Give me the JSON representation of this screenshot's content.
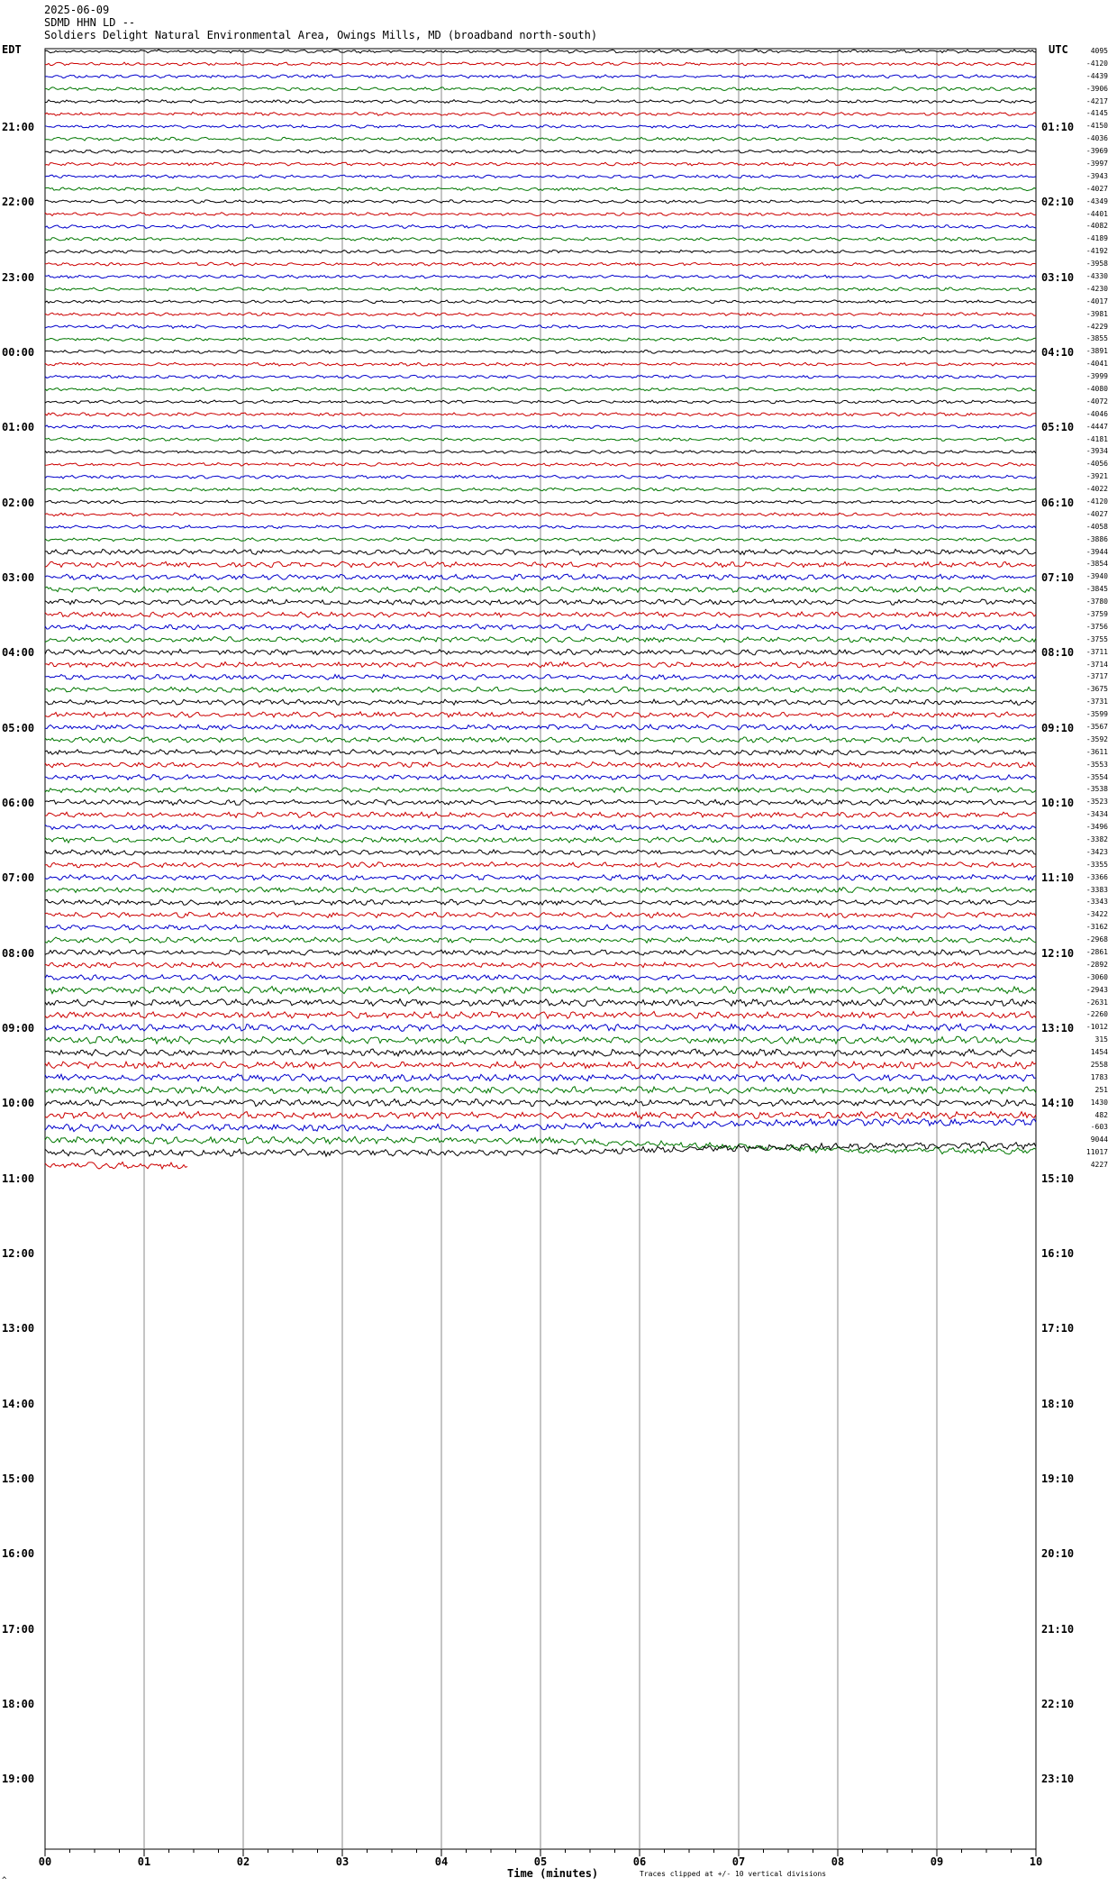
{
  "header": {
    "date": "2025-06-09",
    "station": "SDMD HHN LD --",
    "location": "Soldiers Delight Natural Environmental Area, Owings Mills, MD (broadband north-south)"
  },
  "left_tz": "EDT",
  "right_tz": "UTC",
  "left_hours": [
    "21:00",
    "22:00",
    "23:00",
    "00:00",
    "01:00",
    "02:00",
    "03:00",
    "04:00",
    "05:00",
    "06:00",
    "07:00",
    "08:00",
    "09:00",
    "10:00",
    "11:00",
    "12:00",
    "13:00",
    "14:00",
    "15:00",
    "16:00",
    "17:00",
    "18:00",
    "19:00"
  ],
  "right_hours": [
    "01:10",
    "02:10",
    "03:10",
    "04:10",
    "05:10",
    "06:10",
    "07:10",
    "08:10",
    "09:10",
    "10:10",
    "11:10",
    "12:10",
    "13:10",
    "14:10",
    "15:10",
    "16:10",
    "17:10",
    "18:10",
    "19:10",
    "20:10",
    "21:10",
    "22:10",
    "23:10"
  ],
  "chart_data": {
    "type": "line",
    "title": "",
    "xlabel": "Time (minutes)",
    "xlim": [
      0,
      10
    ],
    "x_ticks": [
      "00",
      "01",
      "02",
      "03",
      "04",
      "05",
      "06",
      "07",
      "08",
      "09",
      "10"
    ],
    "trace_colors": [
      "#000000",
      "#cc0000",
      "#0000cc",
      "#007700"
    ],
    "trace_offsets": [
      "4095",
      "-4120",
      "-4439",
      "-3906",
      "-4217",
      "-4145",
      "-4150",
      "-4036",
      "-3969",
      "-3997",
      "-3943",
      "-4027",
      "-4349",
      "-4401",
      "-4082",
      "-4189",
      "-4192",
      "-3958",
      "-4330",
      "-4230",
      "-4017",
      "-3981",
      "-4229",
      "-3855",
      "-3891",
      "-4041",
      "-3999",
      "-4080",
      "-4072",
      "-4046",
      "-4447",
      "-4181",
      "-3934",
      "-4056",
      "-3921",
      "-4022",
      "-4120",
      "-4027",
      "-4058",
      "-3886",
      "-3944",
      "-3854",
      "-3940",
      "-3845",
      "-3780",
      "-3759",
      "-3756",
      "-3755",
      "-3711",
      "-3714",
      "-3717",
      "-3675",
      "-3731",
      "-3599",
      "-3567",
      "-3592",
      "-3611",
      "-3553",
      "-3554",
      "-3538",
      "-3523",
      "-3434",
      "-3496",
      "-3382",
      "-3423",
      "-3355",
      "-3366",
      "-3383",
      "-3343",
      "-3422",
      "-3162",
      "-2968",
      "-2861",
      "-2892",
      "-3060",
      "-2943",
      "-2631",
      "-2260",
      "-1012",
      "315",
      "1454",
      "2558",
      "1783",
      "251",
      "1430",
      "482",
      "-603",
      "9044",
      "11017",
      "4227"
    ],
    "trace_count": 90,
    "note": "Traces clipped at +/- 10 vertical divisions"
  },
  "footer_mark": "^"
}
